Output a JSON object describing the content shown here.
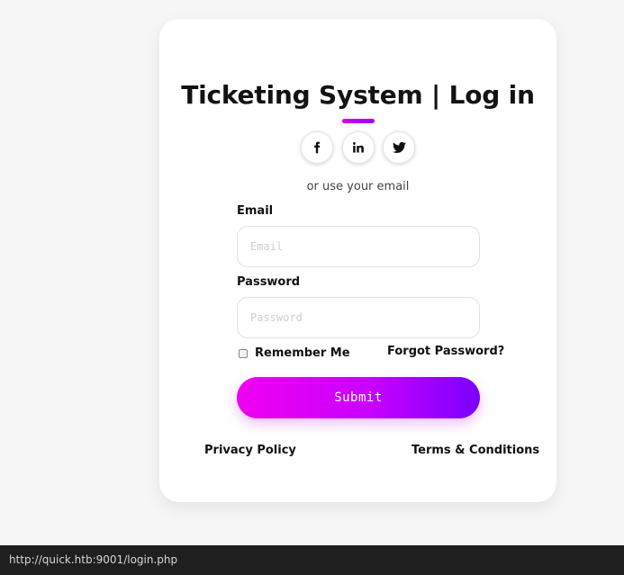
{
  "login_card": {
    "title": "Ticketing System | Log in",
    "social": [
      {
        "icon": "facebook-icon",
        "label": "f"
      },
      {
        "icon": "linkedin-icon",
        "label": "in"
      },
      {
        "icon": "twitter-icon",
        "label": "twitter"
      }
    ],
    "use_email_text": "or use your email",
    "email_label": "Email",
    "email_placeholder": "Email",
    "email_value": "",
    "password_label": "Password",
    "password_placeholder": "Password",
    "password_value": "",
    "remember_label": "Remember Me",
    "remember_checked": false,
    "forgot_label": "Forgot Password?",
    "submit_label": "Submit",
    "privacy_label": "Privacy Policy",
    "terms_label": "Terms & Conditions"
  },
  "status_bar": {
    "url": "http://quick.htb:9001/login.php"
  },
  "colors": {
    "accent_start": "#f000f0",
    "accent_end": "#7a00ff",
    "background": "#f6f6f6",
    "card": "#ffffff",
    "status_bar": "#1f1f1f"
  }
}
